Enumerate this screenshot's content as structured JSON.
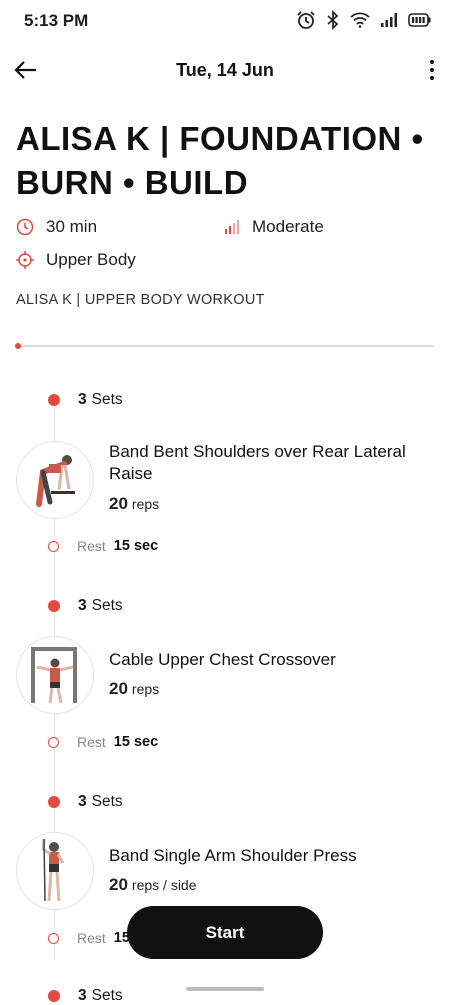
{
  "status_bar": {
    "time": "5:13 PM"
  },
  "header": {
    "title": "Tue, 14 Jun"
  },
  "workout": {
    "title": "ALISA K | FOUNDATION • BURN • BUILD",
    "duration": "30 min",
    "intensity": "Moderate",
    "focus": "Upper Body",
    "subtitle": "ALISA K | UPPER BODY WORKOUT"
  },
  "colors": {
    "accent": "#e24a3e"
  },
  "exercises": [
    {
      "sets_count": "3",
      "sets_label": "Sets",
      "name": "Band Bent Shoulders over Rear Lateral Raise",
      "reps": "20",
      "reps_unit": "reps",
      "rest_label": "Rest",
      "rest_value": "15 sec"
    },
    {
      "sets_count": "3",
      "sets_label": "Sets",
      "name": "Cable Upper Chest Crossover",
      "reps": "20",
      "reps_unit": "reps",
      "rest_label": "Rest",
      "rest_value": "15 sec"
    },
    {
      "sets_count": "3",
      "sets_label": "Sets",
      "name": "Band Single Arm Shoulder Press",
      "reps": "20",
      "reps_unit": "reps / side",
      "rest_label": "Rest",
      "rest_value": "15 sec"
    },
    {
      "sets_count": "3",
      "sets_label": "Sets"
    }
  ],
  "actions": {
    "start_label": "Start"
  },
  "icons": {
    "back": "arrow-left-icon",
    "more": "more-vertical-icon",
    "duration": "clock-icon",
    "intensity": "signal-bars-icon",
    "focus": "target-icon"
  }
}
